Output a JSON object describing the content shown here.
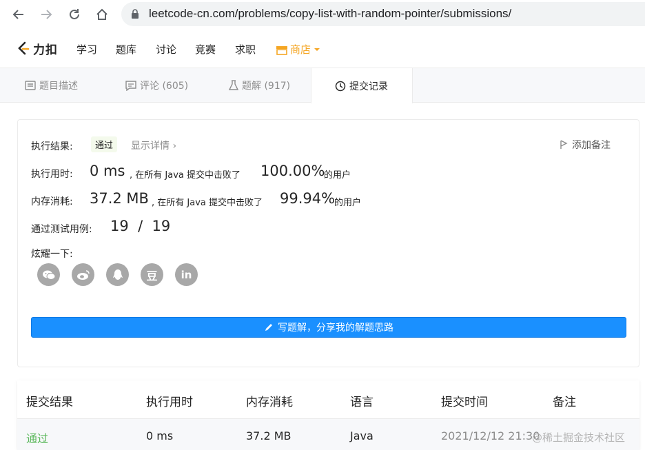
{
  "browser": {
    "url": "leetcode-cn.com/problems/copy-list-with-random-pointer/submissions/"
  },
  "header": {
    "logo_text": "力扣",
    "nav": [
      "学习",
      "题库",
      "讨论",
      "竞赛",
      "求职"
    ],
    "shop_label": "商店",
    "shop_color": "#f5a623"
  },
  "tabs": [
    {
      "label": "题目描述",
      "icon": "description-icon"
    },
    {
      "label": "评论 (605)",
      "icon": "comment-icon"
    },
    {
      "label": "题解 (917)",
      "icon": "flask-icon"
    },
    {
      "label": "提交记录",
      "icon": "clock-icon",
      "active": true
    }
  ],
  "result": {
    "exec_label": "执行结果:",
    "status": "通过",
    "detail_link": "显示详情 ›",
    "add_note": "添加备注",
    "runtime_label": "执行用时:",
    "runtime_value": "0 ms",
    "runtime_mid": ", 在所有 Java 提交中击败了",
    "runtime_pct": "100.00%",
    "runtime_suffix": "的用户",
    "memory_label": "内存消耗:",
    "memory_value": "37.2 MB",
    "memory_mid": ", 在所有 Java 提交中击败了",
    "memory_pct": "99.94%",
    "memory_suffix": "的用户",
    "tests_label": "通过测试用例:",
    "tests_value": "19  /  19",
    "share_label": "炫耀一下:",
    "share_icons": [
      "wechat-icon",
      "weibo-icon",
      "qq-icon",
      "douban-icon",
      "linkedin-icon"
    ],
    "douban_glyph": "豆",
    "linkedin_glyph": "in",
    "write_button": "写题解，分享我的解题思路"
  },
  "table": {
    "headers": [
      "提交结果",
      "执行用时",
      "内存消耗",
      "语言",
      "提交时间",
      "备注"
    ],
    "rows": [
      {
        "result": "通过",
        "runtime": "0 ms",
        "memory": "37.2 MB",
        "language": "Java",
        "time": "2021/12/12 21:30"
      }
    ]
  },
  "watermark": "@稀土掘金技术社区",
  "colors": {
    "accent": "#1a90ff",
    "pass": "#5cb85c",
    "shop": "#f5a623"
  }
}
